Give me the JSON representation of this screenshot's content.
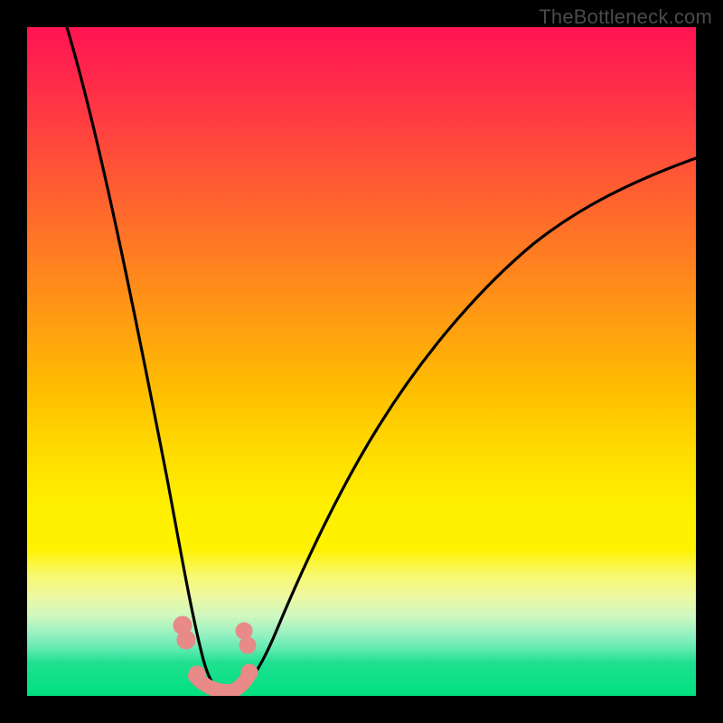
{
  "watermark": "TheBottleneck.com",
  "chart_data": {
    "type": "line",
    "title": "",
    "xlabel": "",
    "ylabel": "",
    "xlim": [
      0,
      100
    ],
    "ylim": [
      0,
      100
    ],
    "series": [
      {
        "name": "curve",
        "x": [
          6,
          10,
          15,
          20,
          22,
          24,
          25,
          26,
          27,
          28,
          30,
          32,
          35,
          40,
          45,
          50,
          55,
          60,
          65,
          70,
          75,
          80,
          85,
          90,
          95,
          100
        ],
        "y": [
          100,
          80,
          56,
          30,
          18,
          8,
          2,
          0,
          0,
          0,
          2,
          6,
          14,
          28,
          38,
          46,
          52,
          57,
          61,
          64,
          67,
          69,
          71,
          73,
          74,
          75
        ]
      }
    ],
    "highlight_points_x": [
      21,
      21.5,
      25,
      26.5,
      27.5,
      28.5,
      29.5,
      30,
      30.5
    ],
    "highlight_points_y": [
      12,
      10,
      0.5,
      0.3,
      0.5,
      1,
      4,
      8,
      10
    ],
    "highlight_color": "#e88a88",
    "background_gradient": {
      "top": "#ff1452",
      "middle": "#ffe000",
      "bottom": "#00e080"
    }
  }
}
